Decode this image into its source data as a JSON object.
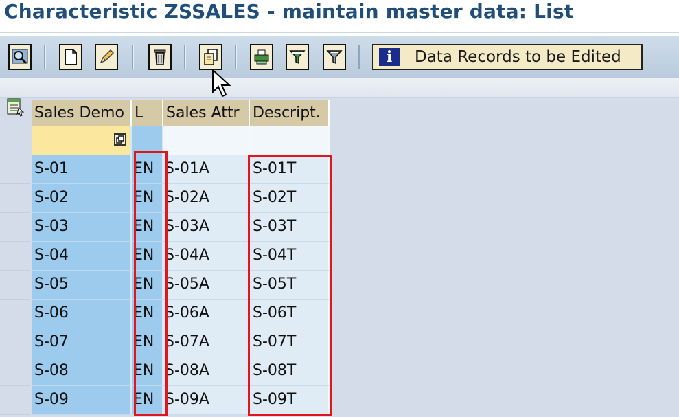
{
  "title": "Characteristic ZSSALES - maintain master data: List",
  "toolbar": {
    "buttons": [
      {
        "icon": "search-icon"
      },
      {
        "icon": "create-icon"
      },
      {
        "icon": "change-pencil-icon"
      },
      {
        "icon": "delete-icon"
      },
      {
        "icon": "copy-icon"
      },
      {
        "icon": "print-icon"
      },
      {
        "icon": "filter-icon"
      },
      {
        "icon": "set-filter-icon"
      }
    ],
    "info_button_label": "Data Records to be Edited"
  },
  "table": {
    "columns": [
      "Sales Demo",
      "L",
      "Sales Attr",
      "Descript."
    ],
    "rows": [
      {
        "key": "S-01",
        "lang": "EN",
        "attr": "S-01A",
        "desc": "S-01T"
      },
      {
        "key": "S-02",
        "lang": "EN",
        "attr": "S-02A",
        "desc": "S-02T"
      },
      {
        "key": "S-03",
        "lang": "EN",
        "attr": "S-03A",
        "desc": "S-03T"
      },
      {
        "key": "S-04",
        "lang": "EN",
        "attr": "S-04A",
        "desc": "S-04T"
      },
      {
        "key": "S-05",
        "lang": "EN",
        "attr": "S-05A",
        "desc": "S-05T"
      },
      {
        "key": "S-06",
        "lang": "EN",
        "attr": "S-06A",
        "desc": "S-06T"
      },
      {
        "key": "S-07",
        "lang": "EN",
        "attr": "S-07A",
        "desc": "S-07T"
      },
      {
        "key": "S-08",
        "lang": "EN",
        "attr": "S-08A",
        "desc": "S-08T"
      },
      {
        "key": "S-09",
        "lang": "EN",
        "attr": "S-09A",
        "desc": "S-09T"
      }
    ]
  },
  "colors": {
    "title": "#1f4e79",
    "key_column": "#9ccbee",
    "highlight": "#e0161c",
    "header": "#d6c9a6"
  }
}
